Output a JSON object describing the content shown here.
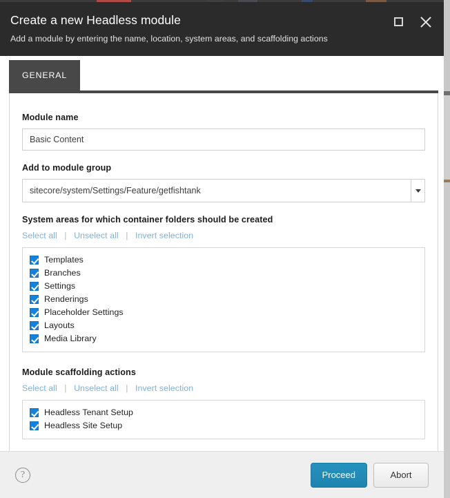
{
  "window": {
    "title": "Create a new Headless module",
    "subtitle": "Add a module by entering the name, location, system areas, and scaffolding actions",
    "maximize_icon": "maximize-icon",
    "close_icon": "close-icon"
  },
  "tabs": [
    {
      "label": "GENERAL",
      "active": true
    }
  ],
  "form": {
    "module_name": {
      "label": "Module name",
      "value": "Basic Content",
      "placeholder": ""
    },
    "module_group": {
      "label": "Add to module group",
      "value": "sitecore/system/Settings/Feature/getfishtank",
      "placeholder": "",
      "dropdown_icon": "chevron-down-icon"
    }
  },
  "system_areas": {
    "title": "System areas for which container folders should be created",
    "links": {
      "select_all": "Select all",
      "unselect_all": "Unselect all",
      "invert_selection": "Invert selection",
      "separator": "|"
    },
    "items": [
      {
        "label": "Templates",
        "checked": true
      },
      {
        "label": "Branches",
        "checked": true
      },
      {
        "label": "Settings",
        "checked": true
      },
      {
        "label": "Renderings",
        "checked": true
      },
      {
        "label": "Placeholder Settings",
        "checked": true
      },
      {
        "label": "Layouts",
        "checked": true
      },
      {
        "label": "Media Library",
        "checked": true
      }
    ]
  },
  "scaffolding_actions": {
    "title": "Module scaffolding actions",
    "links": {
      "select_all": "Select all",
      "unselect_all": "Unselect all",
      "invert_selection": "Invert selection",
      "separator": "|"
    },
    "items": [
      {
        "label": "Headless Tenant Setup",
        "checked": true
      },
      {
        "label": "Headless Site Setup",
        "checked": true
      }
    ]
  },
  "footer": {
    "help_icon": "help-icon",
    "help_glyph": "?",
    "proceed_label": "Proceed",
    "abort_label": "Abort"
  },
  "colors": {
    "titlebar_bg": "#2b2b2b",
    "tab_bg": "#484848",
    "checkbox_blue": "#1681d8",
    "link_blue": "#7fb2d6",
    "primary_button": "#2187b4",
    "footer_bg": "#efefef"
  }
}
